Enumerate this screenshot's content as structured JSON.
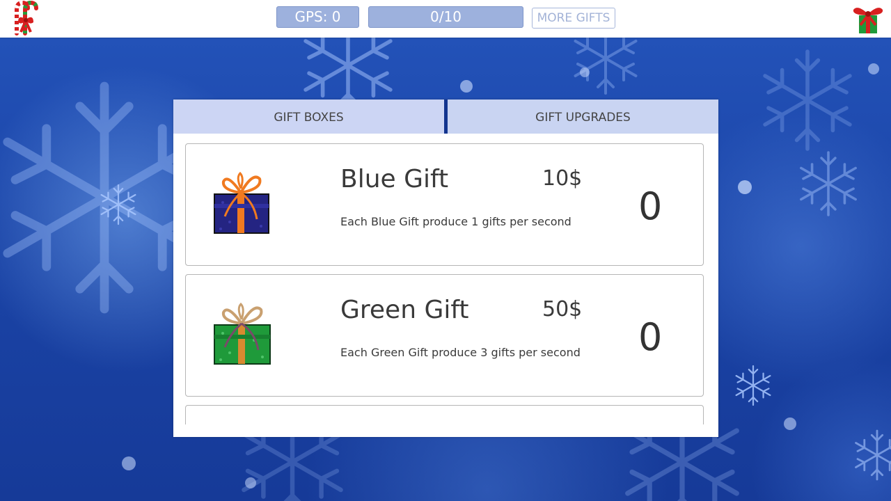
{
  "top_bar": {
    "gps_label": "GPS: 0",
    "progress_label": "0/10",
    "progress_fraction": 0,
    "more_gifts_label": "MORE GIFTS"
  },
  "tabs": [
    {
      "label": "GIFT BOXES",
      "active": true
    },
    {
      "label": "GIFT UPGRADES",
      "active": false
    }
  ],
  "gifts": [
    {
      "name": "Blue Gift",
      "price": "10$",
      "description": "Each Blue Gift produce 1 gifts per second",
      "count": "0",
      "icon": "blue-gift-icon",
      "box_color": "#2a2a8a",
      "ribbon_color": "#f07a20"
    },
    {
      "name": "Green Gift",
      "price": "50$",
      "description": "Each Green Gift produce 3 gifts per second",
      "count": "0",
      "icon": "green-gift-icon",
      "box_color": "#1f9a3a",
      "ribbon_color": "#c9a070"
    }
  ],
  "colors": {
    "accent": "#9db1dd",
    "tab_bg": "#c9d4f2",
    "background": "#1b45a8"
  },
  "icons": {
    "top_left": "candy-cane-icon",
    "top_right": "present-bow-icon"
  }
}
